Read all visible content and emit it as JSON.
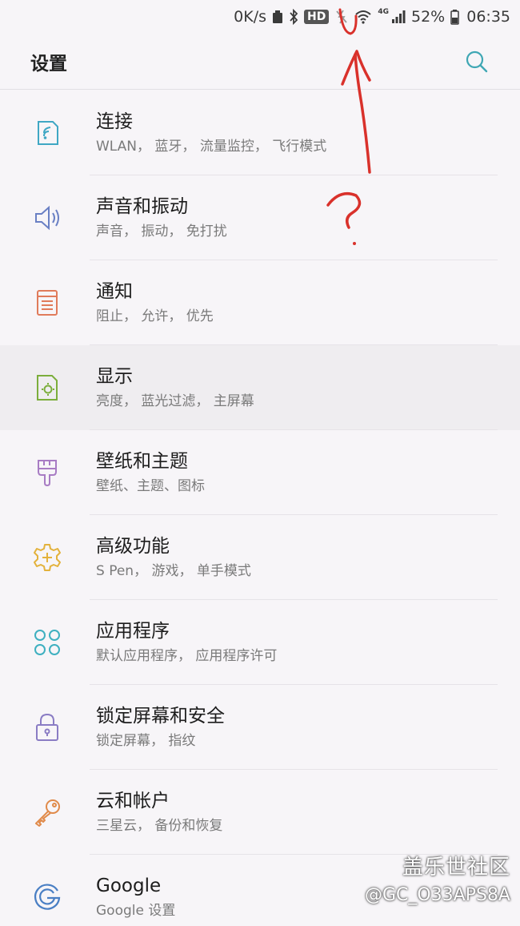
{
  "status_bar": {
    "speed": "0K/s",
    "hd": "HD",
    "network": "4G",
    "battery": "52%",
    "time": "06:35"
  },
  "header": {
    "title": "设置",
    "search_icon": "search-icon"
  },
  "items": [
    {
      "title": "连接",
      "subtitle": "WLAN， 蓝牙， 流量监控， 飞行模式",
      "icon": "connections-icon",
      "color": "#3fa7c4"
    },
    {
      "title": "声音和振动",
      "subtitle": "声音， 振动， 免打扰",
      "icon": "speaker-icon",
      "color": "#6a80c4"
    },
    {
      "title": "通知",
      "subtitle": "阻止， 允许， 优先",
      "icon": "notification-icon",
      "color": "#e07b5b"
    },
    {
      "title": "显示",
      "subtitle": "亮度， 蓝光过滤， 主屏幕",
      "icon": "display-icon",
      "color": "#7cae3c"
    },
    {
      "title": "壁纸和主题",
      "subtitle": "壁纸、主题、图标",
      "icon": "brush-icon",
      "color": "#a87cc4"
    },
    {
      "title": "高级功能",
      "subtitle": "S Pen， 游戏， 单手模式",
      "icon": "gear-plus-icon",
      "color": "#e3b23c"
    },
    {
      "title": "应用程序",
      "subtitle": "默认应用程序， 应用程序许可",
      "icon": "apps-icon",
      "color": "#3fb0c0"
    },
    {
      "title": "锁定屏幕和安全",
      "subtitle": "锁定屏幕， 指纹",
      "icon": "lock-icon",
      "color": "#8a7cc4"
    },
    {
      "title": "云和帐户",
      "subtitle": "三星云， 备份和恢复",
      "icon": "key-icon",
      "color": "#e08a4a"
    },
    {
      "title": "Google",
      "subtitle": "Google 设置",
      "icon": "google-icon",
      "color": "#4a7fc4"
    }
  ],
  "watermark": {
    "title": "盖乐世社区",
    "user": "@GC_O33APS8A"
  },
  "colors": {
    "background": "#f7f5f8",
    "annotation": "#d9312b"
  }
}
